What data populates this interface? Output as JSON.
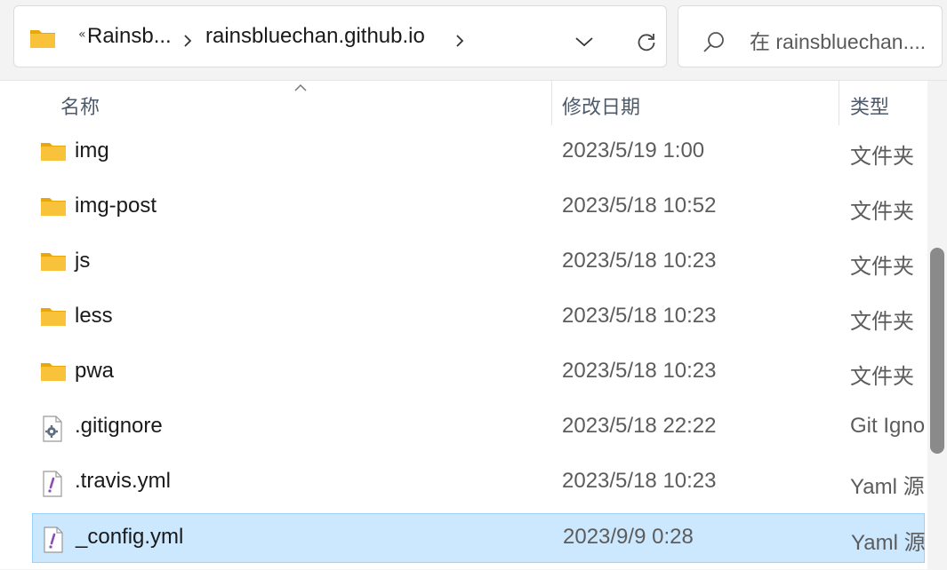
{
  "address": {
    "overflow_glyph": "«",
    "crumbs": [
      "Rainsb...",
      "rainsbluechan.github.io"
    ]
  },
  "search": {
    "placeholder": "在 rainsbluechan...."
  },
  "columns": {
    "name": "名称",
    "modified": "修改日期",
    "type": "类型"
  },
  "files": [
    {
      "name": "img",
      "date": "2023/5/19 1:00",
      "type": "文件夹",
      "icon": "folder-icon",
      "selected": false
    },
    {
      "name": "img-post",
      "date": "2023/5/18 10:52",
      "type": "文件夹",
      "icon": "folder-icon",
      "selected": false
    },
    {
      "name": "js",
      "date": "2023/5/18 10:23",
      "type": "文件夹",
      "icon": "folder-icon",
      "selected": false
    },
    {
      "name": "less",
      "date": "2023/5/18 10:23",
      "type": "文件夹",
      "icon": "folder-icon",
      "selected": false
    },
    {
      "name": "pwa",
      "date": "2023/5/18 10:23",
      "type": "文件夹",
      "icon": "folder-icon",
      "selected": false
    },
    {
      "name": ".gitignore",
      "date": "2023/5/18 22:22",
      "type": "Git Ignore",
      "icon": "gear-file-icon",
      "selected": false
    },
    {
      "name": ".travis.yml",
      "date": "2023/5/18 10:23",
      "type": "Yaml 源",
      "icon": "yaml-file-icon",
      "selected": false
    },
    {
      "name": "_config.yml",
      "date": "2023/9/9 0:28",
      "type": "Yaml 源",
      "icon": "yaml-file-icon",
      "selected": true
    }
  ],
  "colors": {
    "selection": "#cce8ff",
    "folder": "#f8c33a",
    "accent": "#99d1ff"
  }
}
